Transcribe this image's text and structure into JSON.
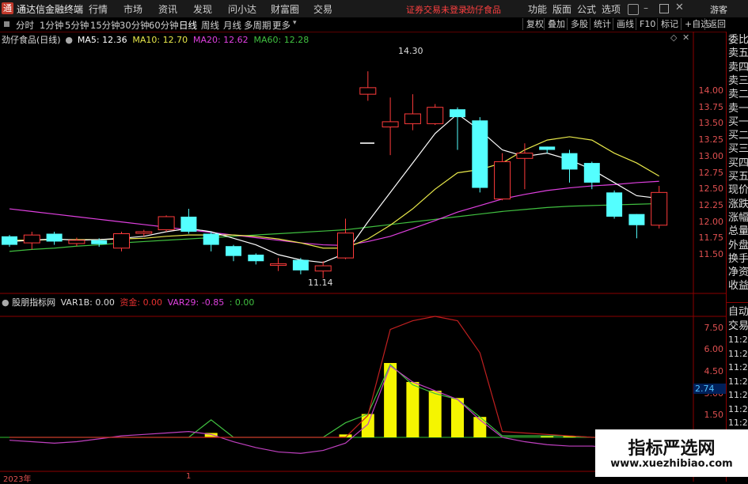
{
  "app": {
    "title": "通达信金融终端"
  },
  "menu": [
    "行情",
    "市场",
    "资讯",
    "发现",
    "问小达",
    "财富圈",
    "交易"
  ],
  "notice": "证券交易未登录",
  "stock_name_top": "劲仔食品",
  "menu_right": [
    "功能",
    "版面",
    "公式",
    "选项"
  ],
  "user": "游客",
  "periods": [
    "分时",
    "1分钟",
    "5分钟",
    "15分钟",
    "30分钟",
    "60分钟",
    "日线",
    "周线",
    "月线",
    "多周期",
    "更多"
  ],
  "active_period": "日线",
  "right_buttons": [
    "复权",
    "叠加",
    "多股",
    "统计",
    "画线",
    "F10",
    "标记",
    "+自选",
    "返回"
  ],
  "main_header": {
    "name": "劲仔食品(日线)",
    "ma5": "MA5: 12.36",
    "ma10": "MA10: 12.70",
    "ma20": "MA20: 12.62",
    "ma60": "MA60: 12.28",
    "colors": {
      "ma5": "#ffffff",
      "ma10": "#e8e84a",
      "ma20": "#e040e0",
      "ma60": "#40c040"
    }
  },
  "price_axis": [
    "14.00",
    "13.75",
    "13.50",
    "13.25",
    "13.00",
    "12.75",
    "12.50",
    "12.25",
    "12.00",
    "11.75",
    "11.50"
  ],
  "high_label": "14.30",
  "low_label": "11.14",
  "sub_header": {
    "name": "股朋指标网",
    "var1b": "VAR1B: 0.00",
    "zijin_label": "资金:",
    "zijin_value": "0.00",
    "var29": "VAR29: -0.85",
    "tail": ": 0.00"
  },
  "sub_axis": [
    "7.50",
    "6.00",
    "4.50",
    "3.00",
    "1.50"
  ],
  "sub_marker": "2.74",
  "right_panel_top": [
    "委比",
    "卖五",
    "卖四",
    "卖三",
    "卖二",
    "卖一",
    "买一",
    "买二",
    "买三",
    "买四",
    "买五",
    "现价",
    "涨跌",
    "涨幅",
    "总量",
    "外盘",
    "换手",
    "净资",
    "收益"
  ],
  "right_panel_bottom": [
    "自动",
    "交易",
    "11:27",
    "11:27",
    "11:27",
    "11:28",
    "11:28",
    "11:28",
    "11:28",
    "11:28",
    "11:28"
  ],
  "time_axis": {
    "left": "2023年",
    "mid": "1"
  },
  "watermark": {
    "title": "指标严选网",
    "url": "www.xuezhibiao.com"
  },
  "chart_data": {
    "type": "candlestick",
    "candles": [
      {
        "o": 11.65,
        "c": 11.78,
        "h": 11.8,
        "l": 11.62,
        "up": false
      },
      {
        "o": 11.8,
        "c": 11.68,
        "h": 11.85,
        "l": 11.58,
        "up": true
      },
      {
        "o": 11.7,
        "c": 11.82,
        "h": 11.85,
        "l": 11.65,
        "up": false
      },
      {
        "o": 11.72,
        "c": 11.67,
        "h": 11.76,
        "l": 11.63,
        "up": true
      },
      {
        "o": 11.66,
        "c": 11.72,
        "h": 11.75,
        "l": 11.62,
        "up": false
      },
      {
        "o": 11.6,
        "c": 11.82,
        "h": 11.85,
        "l": 11.55,
        "up": true
      },
      {
        "o": 11.85,
        "c": 11.85,
        "h": 11.88,
        "l": 11.78,
        "up": true
      },
      {
        "o": 11.88,
        "c": 12.08,
        "h": 12.1,
        "l": 11.85,
        "up": true
      },
      {
        "o": 12.08,
        "c": 11.85,
        "h": 12.2,
        "l": 11.82,
        "up": false
      },
      {
        "o": 11.82,
        "c": 11.65,
        "h": 11.85,
        "l": 11.55,
        "up": false
      },
      {
        "o": 11.63,
        "c": 11.48,
        "h": 11.65,
        "l": 11.4,
        "up": false
      },
      {
        "o": 11.5,
        "c": 11.4,
        "h": 11.52,
        "l": 11.35,
        "up": false
      },
      {
        "o": 11.34,
        "c": 11.36,
        "h": 11.45,
        "l": 11.25,
        "up": true
      },
      {
        "o": 11.42,
        "c": 11.26,
        "h": 11.45,
        "l": 11.2,
        "up": false
      },
      {
        "o": 11.25,
        "c": 11.33,
        "h": 11.4,
        "l": 11.14,
        "up": true
      },
      {
        "o": 11.45,
        "c": 11.83,
        "h": 12.05,
        "l": 11.43,
        "up": true
      },
      {
        "o": 13.95,
        "c": 14.05,
        "h": 14.3,
        "l": 13.85,
        "up": true
      },
      {
        "o": 13.45,
        "c": 13.53,
        "h": 13.9,
        "l": 13.02,
        "up": true
      },
      {
        "o": 13.5,
        "c": 13.65,
        "h": 13.95,
        "l": 13.4,
        "up": true
      },
      {
        "o": 13.5,
        "c": 13.75,
        "h": 13.8,
        "l": 13.48,
        "up": true
      },
      {
        "o": 13.72,
        "c": 13.6,
        "h": 13.75,
        "l": 13.1,
        "up": false
      },
      {
        "o": 13.55,
        "c": 12.52,
        "h": 13.6,
        "l": 12.45,
        "up": false
      },
      {
        "o": 12.35,
        "c": 12.92,
        "h": 13.05,
        "l": 12.33,
        "up": true
      },
      {
        "o": 12.97,
        "c": 13.05,
        "h": 13.2,
        "l": 12.5,
        "up": true
      },
      {
        "o": 13.15,
        "c": 13.1,
        "h": 13.15,
        "l": 13.05,
        "up": false
      },
      {
        "o": 13.05,
        "c": 12.8,
        "h": 13.1,
        "l": 12.6,
        "up": false
      },
      {
        "o": 12.9,
        "c": 12.6,
        "h": 12.92,
        "l": 12.5,
        "up": false
      },
      {
        "o": 12.45,
        "c": 12.08,
        "h": 12.48,
        "l": 12.05,
        "up": false
      },
      {
        "o": 12.12,
        "c": 11.95,
        "h": 12.12,
        "l": 11.75,
        "up": false
      },
      {
        "o": 11.95,
        "c": 12.45,
        "h": 12.55,
        "l": 11.9,
        "up": true
      }
    ],
    "ma5": [
      11.7,
      11.72,
      11.74,
      11.72,
      11.73,
      11.75,
      11.78,
      11.85,
      11.9,
      11.85,
      11.75,
      11.65,
      11.5,
      11.42,
      11.38,
      11.52,
      12.0,
      12.45,
      12.9,
      13.35,
      13.65,
      13.4,
      13.1,
      13.0,
      13.05,
      12.95,
      12.8,
      12.6,
      12.4,
      12.36
    ],
    "ma10": [
      11.72,
      11.72,
      11.73,
      11.73,
      11.73,
      11.74,
      11.75,
      11.78,
      11.8,
      11.8,
      11.8,
      11.78,
      11.74,
      11.68,
      11.6,
      11.6,
      11.74,
      11.95,
      12.2,
      12.5,
      12.75,
      12.8,
      12.9,
      13.1,
      13.25,
      13.3,
      13.25,
      13.05,
      12.9,
      12.7
    ],
    "ma20": [
      12.2,
      12.16,
      12.12,
      12.08,
      12.04,
      12.0,
      11.96,
      11.92,
      11.88,
      11.84,
      11.8,
      11.76,
      11.72,
      11.68,
      11.65,
      11.64,
      11.7,
      11.78,
      11.9,
      12.02,
      12.15,
      12.25,
      12.35,
      12.42,
      12.48,
      12.52,
      12.55,
      12.57,
      12.6,
      12.62
    ],
    "ma60": [
      11.55,
      11.58,
      11.6,
      11.63,
      11.65,
      11.68,
      11.7,
      11.72,
      11.74,
      11.76,
      11.78,
      11.8,
      11.82,
      11.84,
      11.86,
      11.88,
      11.92,
      11.96,
      12.0,
      12.04,
      12.08,
      12.12,
      12.16,
      12.19,
      12.22,
      12.24,
      12.25,
      12.26,
      12.27,
      12.28
    ],
    "sub": {
      "bars": [
        0,
        0,
        0,
        0,
        0,
        0,
        0,
        0,
        0,
        0.3,
        0,
        0,
        0,
        0,
        0,
        0.2,
        1.6,
        5.1,
        3.8,
        3.2,
        2.7,
        1.4,
        0,
        0,
        0.1,
        0.1,
        0,
        0,
        0,
        0
      ],
      "red_curve": [
        0,
        0,
        0,
        0,
        0,
        0,
        0,
        0,
        0,
        0,
        0,
        0,
        0,
        0,
        0,
        0,
        1.5,
        7.4,
        8.0,
        8.3,
        8.0,
        5.8,
        0.4,
        0.3,
        0.2,
        0.1,
        0,
        0,
        0,
        0
      ],
      "purple_curve": [
        -0.2,
        -0.3,
        -0.4,
        -0.3,
        -0.1,
        0.1,
        0.2,
        0.3,
        0.4,
        0.2,
        -0.3,
        -0.7,
        -1.0,
        -1.1,
        -0.9,
        -0.4,
        0.9,
        4.9,
        3.8,
        3.2,
        2.6,
        1.2,
        0,
        -0.3,
        -0.5,
        -0.6,
        -0.6,
        -0.7,
        -0.8,
        -0.85
      ],
      "green_curve": [
        0,
        0,
        0,
        0,
        0,
        0,
        0,
        0,
        0,
        1.2,
        0,
        0,
        0,
        0,
        0,
        1.0,
        1.6,
        5.0,
        3.6,
        3.0,
        2.6,
        1.4,
        0.1,
        0.1,
        0.1,
        0.1,
        0,
        0,
        0,
        0
      ],
      "baseline": 0,
      "ylim": [
        -1.5,
        8.5
      ]
    }
  }
}
